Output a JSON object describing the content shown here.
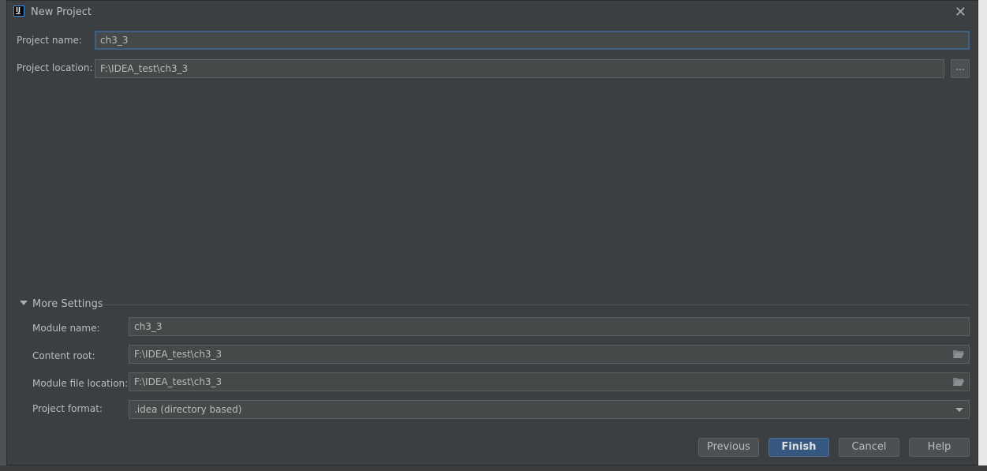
{
  "dialog": {
    "title": "New Project",
    "logo_text": "IJ",
    "close_icon": "close-icon"
  },
  "form": {
    "project_name_label": "Project name:",
    "project_name_value": "ch3_3",
    "project_location_label": "Project location:",
    "project_location_value": "F:\\IDEA_test\\ch3_3",
    "browse_label": "..."
  },
  "more_settings": {
    "label": "More Settings",
    "expanded": true,
    "module_name_label": "Module name:",
    "module_name_value": "ch3_3",
    "content_root_label": "Content root:",
    "content_root_value": "F:\\IDEA_test\\ch3_3",
    "module_file_location_label": "Module file location:",
    "module_file_location_value": "F:\\IDEA_test\\ch3_3",
    "project_format_label": "Project format:",
    "project_format_value": ".idea (directory based)"
  },
  "buttons": {
    "previous": "Previous",
    "finish": "Finish",
    "cancel": "Cancel",
    "help": "Help"
  },
  "colors": {
    "background": "#3c3f41",
    "field": "#45494a",
    "primary_button": "#365880",
    "focus_border": "#3d6185"
  }
}
